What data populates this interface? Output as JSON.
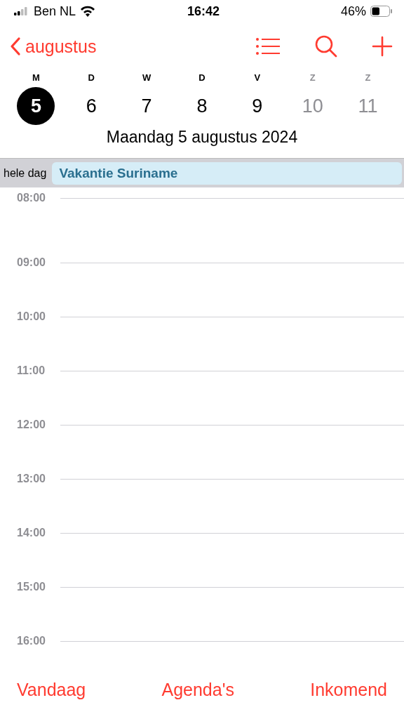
{
  "status_bar": {
    "carrier": "Ben NL",
    "time": "16:42",
    "battery": "46%"
  },
  "nav": {
    "back": "augustus"
  },
  "week": [
    {
      "letter": "M",
      "day": "5",
      "selected": true,
      "weekend": false
    },
    {
      "letter": "D",
      "day": "6",
      "selected": false,
      "weekend": false
    },
    {
      "letter": "W",
      "day": "7",
      "selected": false,
      "weekend": false
    },
    {
      "letter": "D",
      "day": "8",
      "selected": false,
      "weekend": false
    },
    {
      "letter": "V",
      "day": "9",
      "selected": false,
      "weekend": false
    },
    {
      "letter": "Z",
      "day": "10",
      "selected": false,
      "weekend": true
    },
    {
      "letter": "Z",
      "day": "11",
      "selected": false,
      "weekend": true
    }
  ],
  "date_title": {
    "weekday": "Maandag",
    "date": "5 augustus 2024"
  },
  "all_day": {
    "label": "hele dag",
    "events": [
      {
        "title": "Vakantie Suriname",
        "color": "#d6edf7"
      }
    ]
  },
  "hours": [
    "08:00",
    "09:00",
    "10:00",
    "11:00",
    "12:00",
    "13:00",
    "14:00",
    "15:00",
    "16:00"
  ],
  "toolbar": [
    "Vandaag",
    "Agenda's",
    "Inkomend"
  ]
}
